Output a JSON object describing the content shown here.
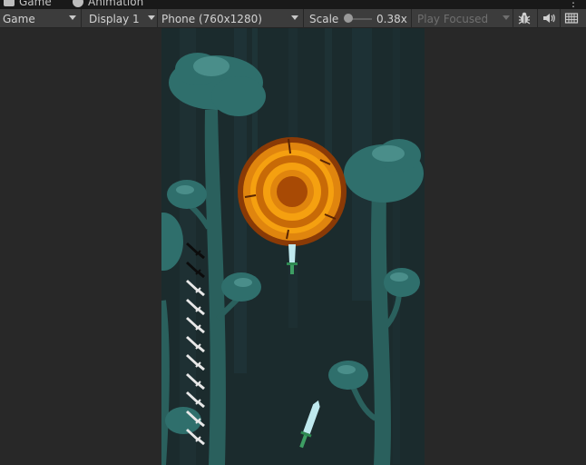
{
  "tabs": [
    {
      "label": "Game",
      "icon": "game-controller-icon"
    },
    {
      "label": "Animation",
      "icon": "animation-icon"
    }
  ],
  "toolbar": {
    "view_mode": "Game",
    "display": "Display 1",
    "resolution": "Phone (760x1280)",
    "scale_label": "Scale",
    "scale_value": "0.38x",
    "scale_fraction": 0.05,
    "play_mode": "Play Focused",
    "icons": [
      "bug-icon",
      "audio-mute-icon",
      "stats-grid-icon"
    ]
  },
  "game": {
    "knives_remaining_total": 11,
    "knives_used": 2,
    "colors": {
      "background": "#1a2a2c",
      "tree_teal": "#2f6f6c",
      "log_outer": "#8a3a06",
      "log_ring": "#f5a010",
      "knife_blade": "#bfe9ee",
      "knife_handle": "#3e9e63"
    }
  }
}
